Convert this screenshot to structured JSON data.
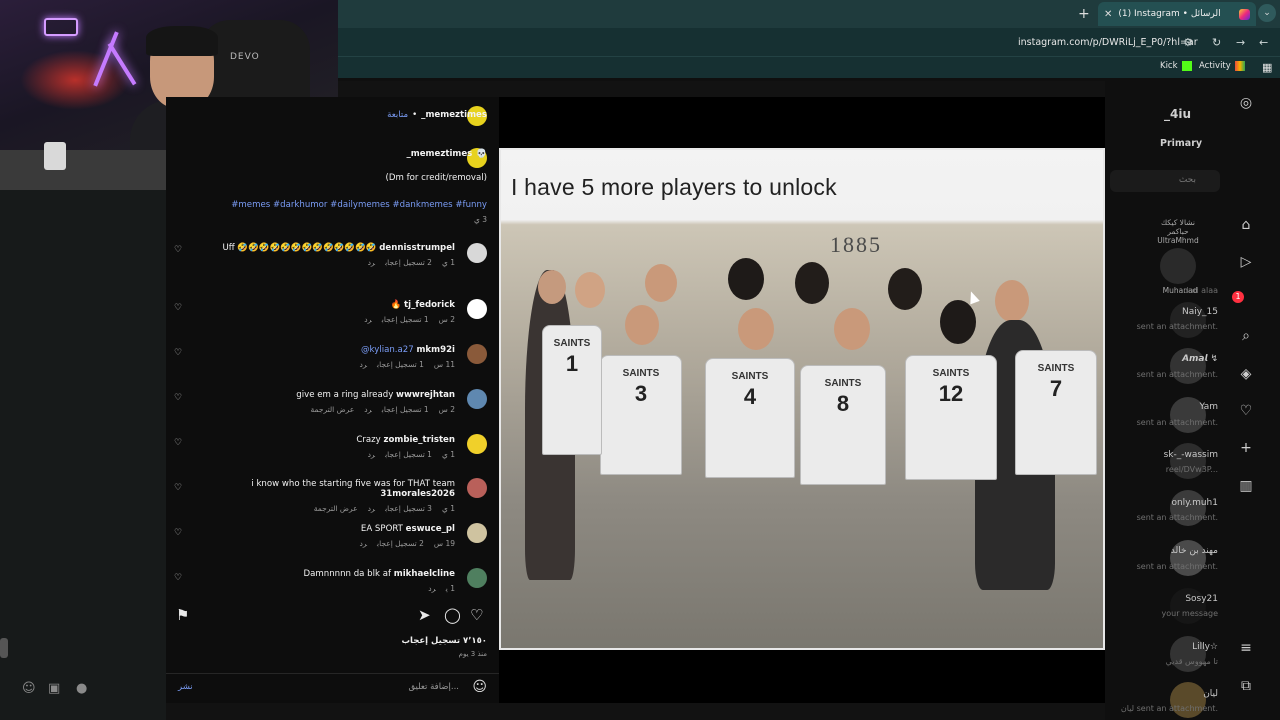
{
  "browser": {
    "tab_title": "(1) Instagram • الرسائل",
    "url": "instagram.com/p/DWRiLj_E_P0/?hl=ar",
    "bookmarks": [
      {
        "label": "Kick"
      },
      {
        "label": "Activity"
      }
    ]
  },
  "webcam": {
    "chair_logo": "DEVO"
  },
  "post": {
    "author": "_memeztimes",
    "follow": "متابعة",
    "caption_author": "_memeztimes",
    "caption_line": "(Dm for credit/removal)",
    "hashtags": "#memes #darkhumor #dailymemes #dankmemes #funny",
    "caption_age": "3 ي",
    "comments": [
      {
        "user": "dennisstrumpel",
        "text": "Uff 🤣🤣🤣🤣🤣🤣🤣🤣🤣🤣🤣🤣🤣",
        "age": "1 ي",
        "likes": "2 تسجيل إعجاب",
        "reply": "رد",
        "translate": ""
      },
      {
        "user": "tj_fedorick",
        "text": "🔥",
        "age": "2 س",
        "likes": "1 تسجيل إعجاب",
        "reply": "رد",
        "translate": ""
      },
      {
        "user": "mkm92i",
        "text": "@kylian.a27",
        "age": "11 س",
        "likes": "1 تسجيل إعجاب",
        "reply": "رد",
        "translate": ""
      },
      {
        "user": "wwwrejhtan",
        "text": "give em a ring already",
        "age": "2 س",
        "likes": "1 تسجيل إعجاب",
        "reply": "رد",
        "translate": "عرض الترجمة"
      },
      {
        "user": "zombie_tristen",
        "text": "Crazy",
        "age": "1 ي",
        "likes": "1 تسجيل إعجاب",
        "reply": "رد",
        "translate": ""
      },
      {
        "user": "31morales2026",
        "text": "i know who the starting five was for THAT team",
        "age": "1 ي",
        "likes": "3 تسجيل إعجاب",
        "reply": "رد",
        "translate": "عرض الترجمة"
      },
      {
        "user": "eswuce_pl",
        "text": "EA SPORT",
        "age": "19 س",
        "likes": "2 تسجيل إعجاب",
        "reply": "رد",
        "translate": ""
      },
      {
        "user": "mikhaelcline",
        "text": "Damnnnnn da blk af",
        "age": "1 ي",
        "likes": "",
        "reply": "رد",
        "translate": ""
      }
    ],
    "like_count": "٧٬١٥٠ تسجيل إعجاب",
    "posted_ago": "منذ 3 يوم",
    "add_comment_placeholder": "إضافة تعليق...",
    "post_label": "نشر"
  },
  "meme": {
    "title": "I have 5 more players to unlock",
    "banner": "1885",
    "team": "SAINTS",
    "jersey_numbers": [
      "1",
      "3",
      "4",
      "8",
      "12",
      "7"
    ]
  },
  "sidebar": {
    "handle": "_4iu",
    "tab": "Primary",
    "search_placeholder": "بحث",
    "stories": [
      {
        "name": "Muhanad"
      },
      {
        "name": "نشالا كيكك حباكمر UltraMhmd"
      }
    ],
    "conversations": [
      {
        "name": "Naiy_15",
        "sub": "sent an attachment."
      },
      {
        "name": "𝘼𝙢𝙖𝙡 ↯",
        "sub": "sent an attachment."
      },
      {
        "name": "Yam",
        "sub": "sent an attachment."
      },
      {
        "name": "sk-_-wassim",
        "sub": "reel/DVw3P..."
      },
      {
        "name": "only.muh1",
        "sub": "sent an attachment."
      },
      {
        "name": "مهند بن خالد",
        "sub": "sent an attachment."
      },
      {
        "name": "Sosy21",
        "sub": "your message"
      },
      {
        "name": "Lilly☆",
        "sub": "تا مهووس قديي"
      },
      {
        "name": "ليان",
        "sub": "ليان sent an attachment."
      }
    ],
    "dm_prefix": "dad alaa",
    "badge": "1"
  },
  "colors": {
    "accent": "#7a9cf5",
    "tab_bg": "#245052",
    "toolbar_bg": "#163032"
  }
}
